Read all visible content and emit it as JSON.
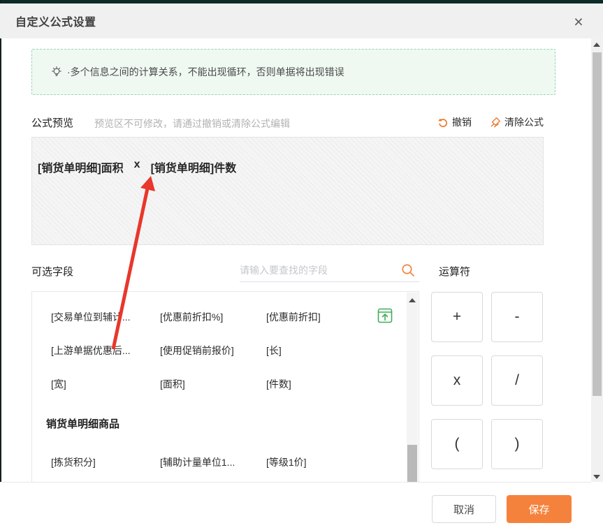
{
  "dialog": {
    "title": "自定义公式设置",
    "close_glyph": "×"
  },
  "hint": {
    "text": "·多个信息之间的计算关系，不能出现循环，否则单据将出现错误"
  },
  "preview": {
    "label": "公式预览",
    "sub_label": "预览区不可修改，请通过撤销或清除公式编辑",
    "undo_label": "撤销",
    "clear_label": "清除公式",
    "formula_tokens": [
      "[销货单明细]面积",
      "x",
      "[销货单明细]件数"
    ]
  },
  "fields": {
    "label": "可选字段",
    "search_placeholder": "请输入要查找的字段",
    "rows": [
      [
        "[交易单位到辅计...",
        "[优惠前折扣%]",
        "[优惠前折扣]"
      ],
      [
        "[上游单据优惠后...",
        "[使用促销前报价]",
        "[长]"
      ],
      [
        "[宽]",
        "[面积]",
        "[件数]"
      ]
    ],
    "group_header": "销货单明细商品",
    "group_rows": [
      [
        "[拣货积分]",
        "[辅助计量单位1...",
        "[等级1价]"
      ]
    ]
  },
  "operators": {
    "label": "运算符",
    "buttons": [
      "+",
      "-",
      "x",
      "/",
      "(",
      ")"
    ]
  },
  "footer": {
    "cancel_label": "取消",
    "save_label": "保存"
  },
  "colors": {
    "accent_orange": "#ED7B2F",
    "save_orange": "#F5823C",
    "hint_border_green": "#95D8AC",
    "hint_bg_green": "#EFF9F2",
    "icon_green": "#3FAE5A",
    "arrow_red": "#E8372B",
    "topbar_dark": "#0D2B26"
  }
}
